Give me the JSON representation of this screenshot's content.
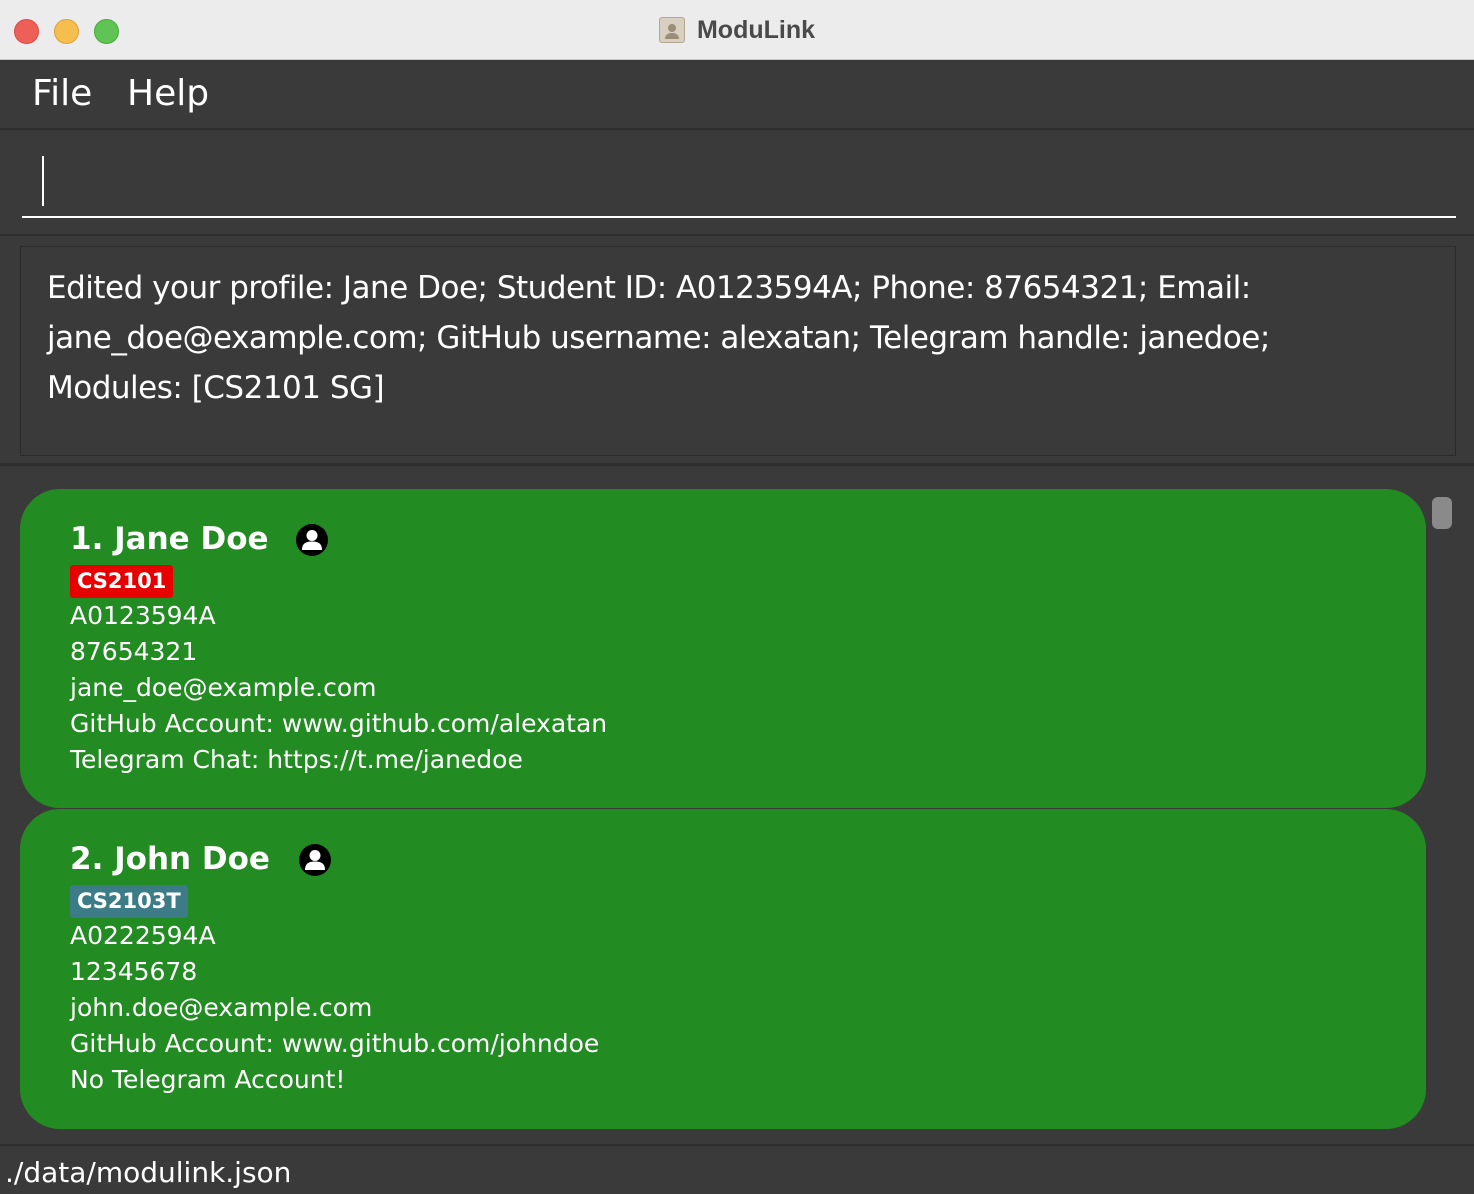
{
  "window": {
    "title": "ModuLink"
  },
  "menu": {
    "items": [
      {
        "label": "File"
      },
      {
        "label": "Help"
      }
    ]
  },
  "command_box": {
    "value": "",
    "placeholder": ""
  },
  "result_display": {
    "line1": "Edited your profile: Jane Doe; Student ID: A0123594A; Phone: 87654321; Email:",
    "line2": "jane_doe@example.com; GitHub username: alexatan; Telegram handle: janedoe;",
    "line3": "Modules: [CS2101 SG]"
  },
  "persons": [
    {
      "name": "1. Jane Doe",
      "tag": "CS2101",
      "tag_color": "#e60000",
      "student_id": "A0123594A",
      "phone": "87654321",
      "email": "jane_doe@example.com",
      "github": "GitHub Account: www.github.com/alexatan",
      "telegram": "Telegram Chat: https://t.me/janedoe",
      "icon": "user-avatar-icon"
    },
    {
      "name": "2. John Doe",
      "tag": "CS2103T",
      "tag_color": "#3b7c86",
      "student_id": "A0222594A",
      "phone": "12345678",
      "email": "john.doe@example.com",
      "github": "GitHub Account: www.github.com/johndoe",
      "telegram": "No Telegram Account!",
      "icon": "user-avatar-icon"
    }
  ],
  "status_bar": {
    "file_path": "./data/modulink.json"
  },
  "colors": {
    "card_bg": "#228b22",
    "window_bg": "#3a3a3a"
  }
}
